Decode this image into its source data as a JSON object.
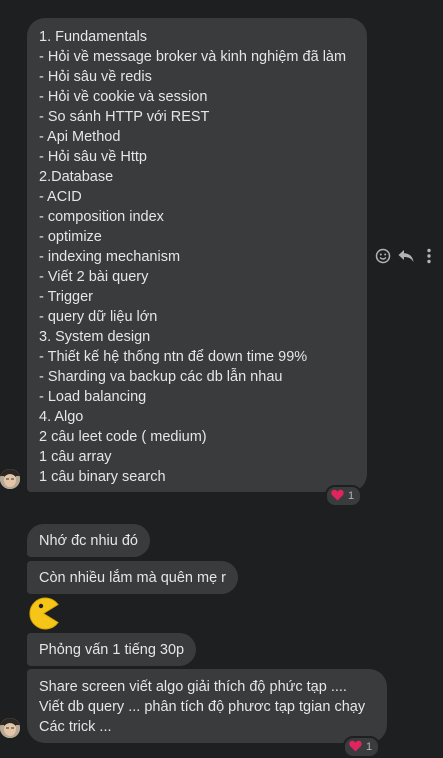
{
  "messages": {
    "first": {
      "lines": [
        "1. Fundamentals",
        "- Hỏi về message broker và kinh nghiệm đã làm",
        "- Hỏi sâu về redis",
        "- Hỏi về cookie và session",
        "- So sánh HTTP với REST",
        "- Api Method",
        "- Hỏi sâu về Http",
        "2.Database",
        "- ACID",
        "- composition index",
        "- optimize",
        "- indexing mechanism",
        "- Viết 2 bài query",
        "- Trigger",
        "- query dữ liệu lớn",
        "3. System design",
        "- Thiết kế hệ thống ntn để down time 99%",
        "- Sharding va backup các db lẫn nhau",
        "- Load balancing",
        "4. Algo",
        "2 câu leet code ( medium)",
        "1 câu array",
        "1 câu binary search"
      ],
      "reaction": {
        "emoji": "❤️",
        "count": "1"
      }
    },
    "second": {
      "text": "Nhớ đc nhiu đó"
    },
    "third": {
      "text": "Còn nhiều lắm mà quên mẹ r"
    },
    "sticker": {
      "icon": "pacman-sticker"
    },
    "fourth": {
      "text": "Phỏng vấn 1 tiếng 30p"
    },
    "fifth": {
      "lines": [
        "Share screen viết algo giải thích độ phức tạp ....",
        "Viết db query ... phân tích độ phươc tạp tgian chạy",
        "Các trick ..."
      ],
      "reaction": {
        "emoji": "❤️",
        "count": "1"
      }
    }
  },
  "colors": {
    "background": "#1e1f21",
    "bubble": "#3a3b3c",
    "text": "#e4e6eb",
    "heart": "#e0245e",
    "pacman": "#f5c518"
  }
}
